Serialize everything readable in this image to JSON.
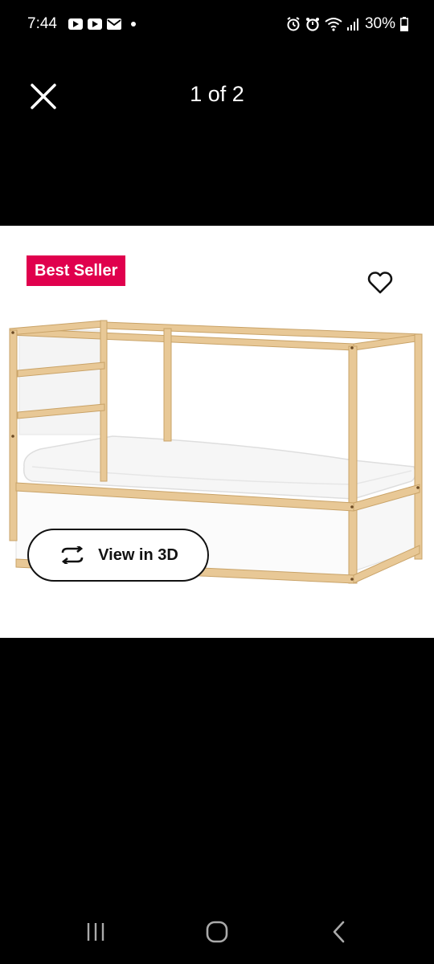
{
  "status_bar": {
    "time": "7:44",
    "notification_icons": [
      "youtube-icon",
      "youtube-icon",
      "mail-icon"
    ],
    "battery": "30%"
  },
  "viewer": {
    "counter": "1 of 2"
  },
  "product": {
    "badge": "Best Seller",
    "view_3d_label": "View in 3D",
    "image_description_icon": "loft-bed-image"
  },
  "colors": {
    "badge_bg": "#e0004d",
    "background": "#000000",
    "panel": "#ffffff"
  }
}
